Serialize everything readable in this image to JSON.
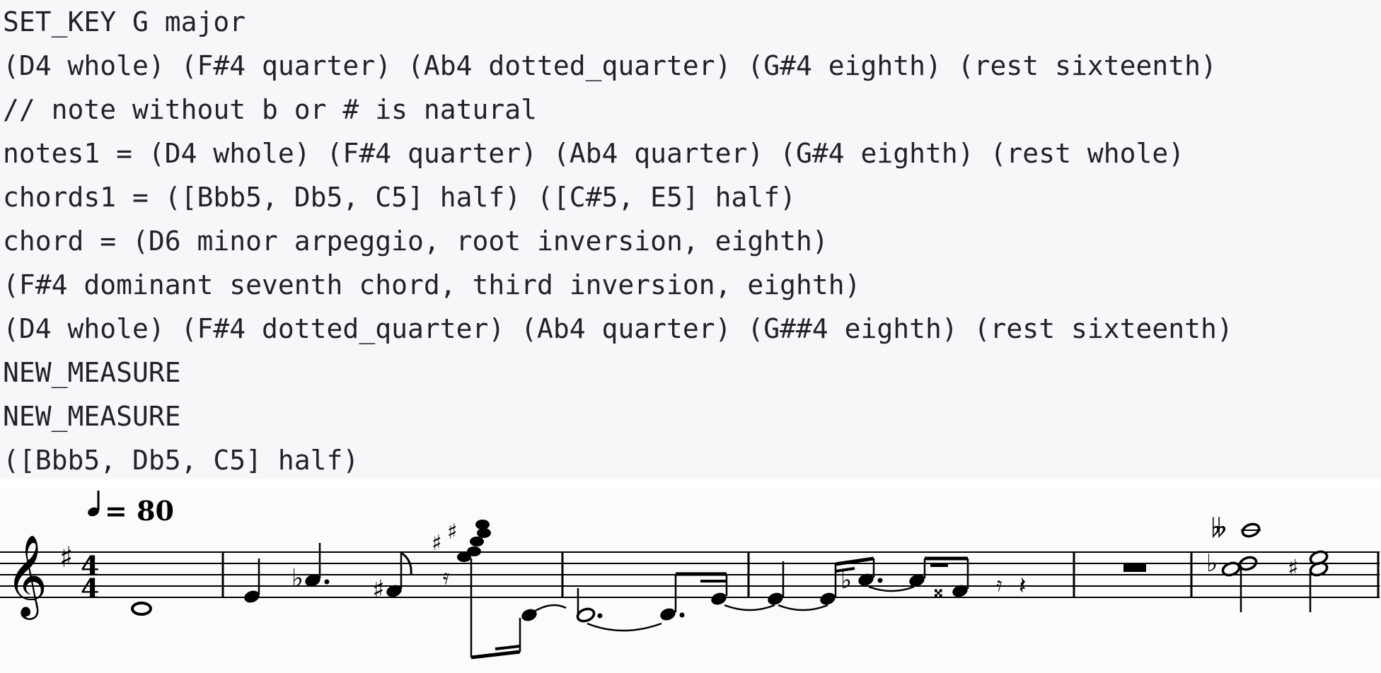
{
  "editor": {
    "lines": [
      "SET_KEY G major",
      "(D4 whole) (F#4 quarter) (Ab4 dotted_quarter) (G#4 eighth) (rest sixteenth)",
      "// note without b or # is natural",
      "notes1 = (D4 whole) (F#4 quarter) (Ab4 quarter) (G#4 eighth) (rest whole)",
      "chords1 = ([Bbb5, Db5, C5] half) ([C#5, E5] half)",
      "chord = (D6 minor arpeggio, root inversion, eighth)",
      "(F#4 dominant seventh chord, third inversion, eighth)",
      "(D4 whole) (F#4 dotted_quarter) (Ab4 quarter) (G##4 eighth) (rest sixteenth)",
      "NEW_MEASURE",
      "NEW_MEASURE",
      "([Bbb5, Db5, C5] half)"
    ]
  },
  "score": {
    "tempo_value": "= 80",
    "time_signature": {
      "top": "4",
      "bottom": "4"
    },
    "key_signature": "G major",
    "clef": "treble-clef-icon",
    "glyphs": {
      "clef": "𝄞",
      "sharp": "♯",
      "flat": "♭",
      "double_flat": "𝄫",
      "double_sharp": "𝄪",
      "quarter_note": "♩",
      "sixteenth_rest": "𝄿",
      "quarter_rest": "𝄽"
    }
  }
}
